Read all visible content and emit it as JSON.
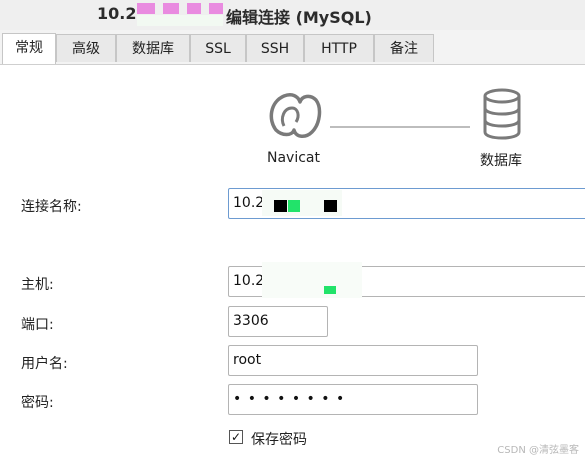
{
  "window": {
    "title_prefix": "10.2",
    "title_suffix": "编辑连接 (MySQL)"
  },
  "tabs": [
    {
      "label": "常规",
      "active": true
    },
    {
      "label": "高级"
    },
    {
      "label": "数据库"
    },
    {
      "label": "SSL"
    },
    {
      "label": "SSH"
    },
    {
      "label": "HTTP"
    },
    {
      "label": "备注"
    }
  ],
  "header": {
    "client_label": "Navicat",
    "server_label": "数据库"
  },
  "form": {
    "connection_name": {
      "label": "连接名称:",
      "value": "10.2"
    },
    "host": {
      "label": "主机:",
      "value": "10.2"
    },
    "port": {
      "label": "端口:",
      "value": "3306"
    },
    "username": {
      "label": "用户名:",
      "value": "root"
    },
    "password": {
      "label": "密码:",
      "value": "• • • • • • • •"
    },
    "save_password": {
      "label": "保存密码",
      "checked": true,
      "mark": "✓"
    }
  },
  "watermark": "CSDN @清弦墨客",
  "colors": {
    "redaction_pink": "#e98be0",
    "redaction_green": "#22e36a",
    "focus_border": "#6d9bd1"
  }
}
